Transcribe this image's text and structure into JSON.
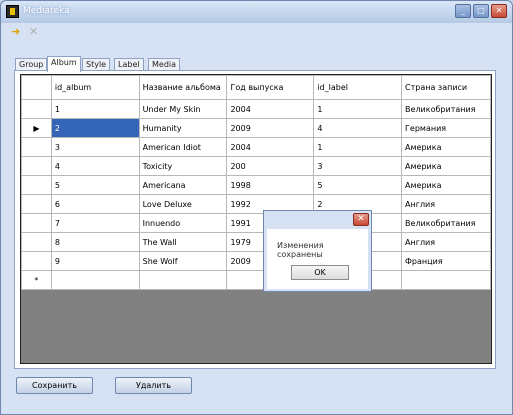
{
  "window": {
    "title": "Mediateka"
  },
  "tabs": [
    "Group",
    "Album",
    "Style",
    "Label",
    "Media"
  ],
  "grid": {
    "columns": [
      "id_album",
      "Название альбома",
      "Год выпуска",
      "id_label",
      "Страна записи"
    ],
    "rows": [
      [
        "1",
        "Under My Skin",
        "2004",
        "1",
        "Великобритания"
      ],
      [
        "2",
        "Humanity",
        "2009",
        "4",
        "Германия"
      ],
      [
        "3",
        "American Idiot",
        "2004",
        "1",
        "Америка"
      ],
      [
        "4",
        "Toxicity",
        "200",
        "3",
        "Америка"
      ],
      [
        "5",
        "Americana",
        "1998",
        "5",
        "Америка"
      ],
      [
        "6",
        "Love Deluxe",
        "1992",
        "2",
        "Англия"
      ],
      [
        "7",
        "Innuendo",
        "1991",
        "",
        "Великобритания"
      ],
      [
        "8",
        "The Wall",
        "1979",
        "",
        "Англия"
      ],
      [
        "9",
        "She Wolf",
        "2009",
        "",
        "Франция"
      ]
    ],
    "current_row_marker": "▶",
    "new_row_marker": "*"
  },
  "dialog": {
    "message": "Изменения сохранены",
    "ok_label": "OK"
  },
  "buttons": {
    "save_label": "Сохранить",
    "delete_label": "Удалить"
  }
}
